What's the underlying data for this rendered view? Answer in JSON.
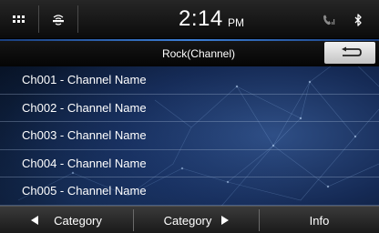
{
  "status_bar": {
    "time": "2:14",
    "ampm": "PM",
    "icons": [
      "menu-grid-icon",
      "siriusxm-icon",
      "phone-signal-icon",
      "bluetooth-icon"
    ]
  },
  "header": {
    "title": "Rock(Channel)",
    "back_icon": "return-arrow-icon",
    "accent_color": "#3d7fd6"
  },
  "channels": [
    {
      "label": "Ch001 - Channel Name"
    },
    {
      "label": "Ch002 - Channel Name"
    },
    {
      "label": "Ch003 - Channel Name"
    },
    {
      "label": "Ch004 - Channel Name"
    },
    {
      "label": "Ch005 - Channel Name"
    }
  ],
  "footer": {
    "prev_category": "Category",
    "next_category": "Category",
    "info": "Info"
  }
}
